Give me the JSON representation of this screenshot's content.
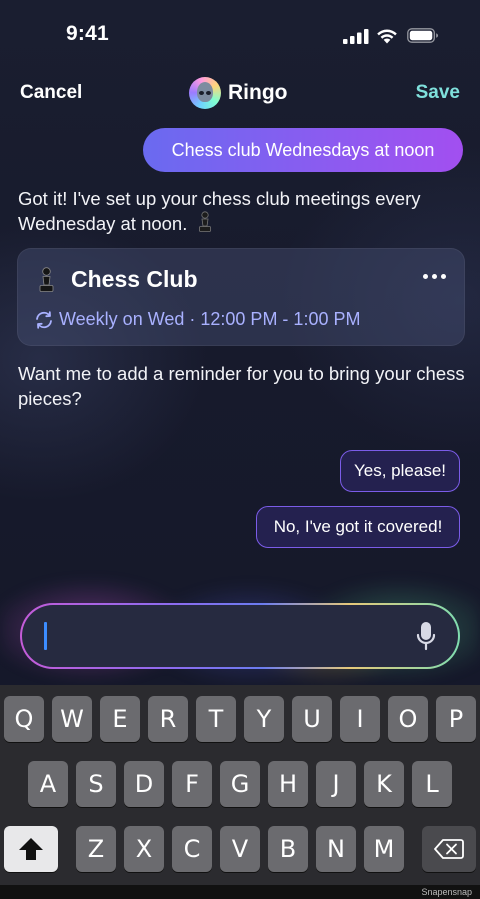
{
  "status_bar": {
    "time": "9:41"
  },
  "nav": {
    "cancel": "Cancel",
    "title": "Ringo",
    "save": "Save"
  },
  "chat": {
    "user_message": "Chess club Wednesdays at noon",
    "assistant_message_1": "Got it! I've set up your chess club meetings every Wednesday at noon.",
    "event": {
      "title": "Chess Club",
      "recurrence": "Weekly on Wed · 12:00 PM - 1:00 PM"
    },
    "assistant_message_2": "Want me to add a reminder for you to bring your chess pieces?",
    "quick_replies": [
      "Yes, please!",
      "No, I've got it covered!"
    ]
  },
  "input": {
    "value": ""
  },
  "keyboard": {
    "row1": [
      "Q",
      "W",
      "E",
      "R",
      "T",
      "Y",
      "U",
      "I",
      "O",
      "P"
    ],
    "row2": [
      "A",
      "S",
      "D",
      "F",
      "G",
      "H",
      "J",
      "K",
      "L"
    ],
    "row3": [
      "Z",
      "X",
      "C",
      "V",
      "B",
      "N",
      "M"
    ]
  },
  "watermark": "Snapensnap",
  "colors": {
    "accent_save": "#7fe0dc",
    "user_bubble": "#8a5cf0",
    "chip_border": "#7b5ce8",
    "recurrence_text": "#a9b1ff"
  }
}
